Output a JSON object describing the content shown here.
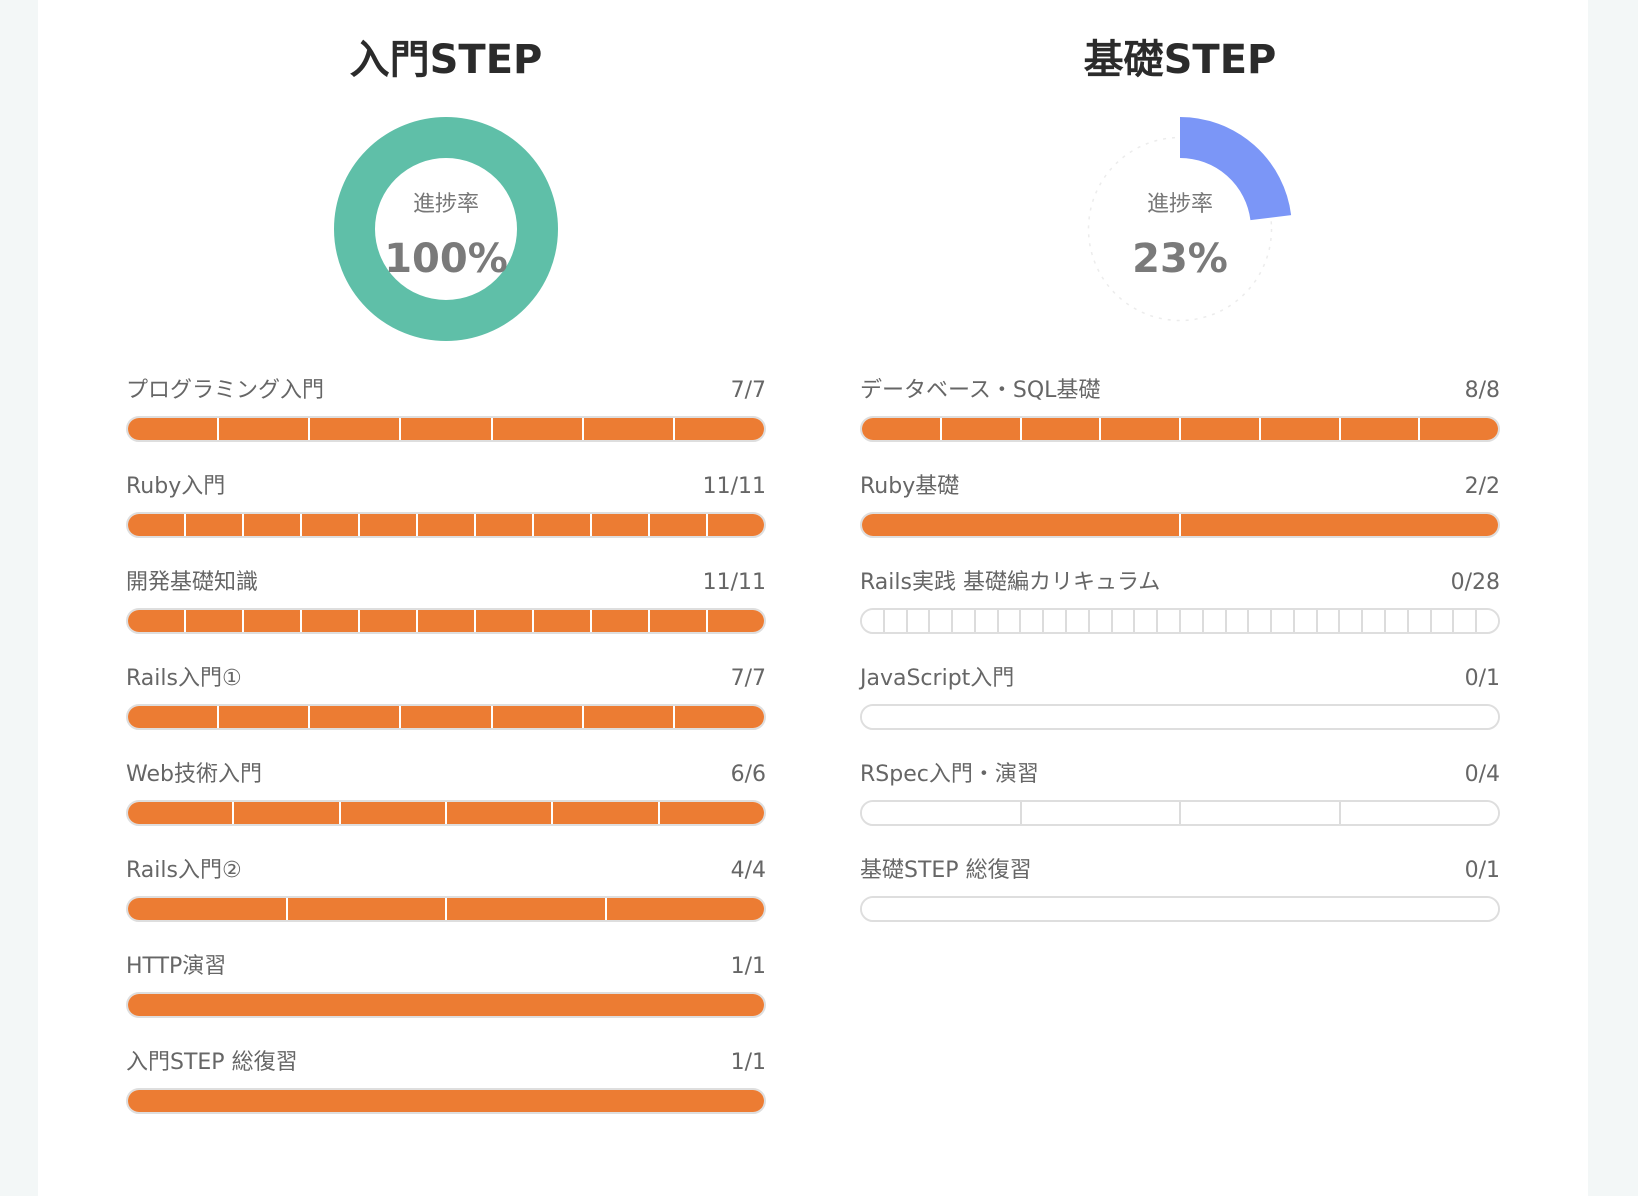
{
  "progress_label": "進捗率",
  "steps": [
    {
      "title": "入門STEP",
      "percent_text": "100%",
      "percent": 100,
      "color": "#5fbfa8",
      "courses": [
        {
          "name": "プログラミング入門",
          "count": "7/7",
          "done": 7,
          "total": 7
        },
        {
          "name": "Ruby入門",
          "count": "11/11",
          "done": 11,
          "total": 11
        },
        {
          "name": "開発基礎知識",
          "count": "11/11",
          "done": 11,
          "total": 11
        },
        {
          "name": "Rails入門①",
          "count": "7/7",
          "done": 7,
          "total": 7
        },
        {
          "name": "Web技術入門",
          "count": "6/6",
          "done": 6,
          "total": 6
        },
        {
          "name": "Rails入門②",
          "count": "4/4",
          "done": 4,
          "total": 4
        },
        {
          "name": "HTTP演習",
          "count": "1/1",
          "done": 1,
          "total": 1
        },
        {
          "name": "入門STEP 総復習",
          "count": "1/1",
          "done": 1,
          "total": 1
        }
      ]
    },
    {
      "title": "基礎STEP",
      "percent_text": "23%",
      "percent": 23,
      "color": "#7b96f7",
      "courses": [
        {
          "name": "データベース・SQL基礎",
          "count": "8/8",
          "done": 8,
          "total": 8
        },
        {
          "name": "Ruby基礎",
          "count": "2/2",
          "done": 2,
          "total": 2
        },
        {
          "name": "Rails実践 基礎編カリキュラム",
          "count": "0/28",
          "done": 0,
          "total": 28
        },
        {
          "name": "JavaScript入門",
          "count": "0/1",
          "done": 0,
          "total": 1
        },
        {
          "name": "RSpec入門・演習",
          "count": "0/4",
          "done": 0,
          "total": 4
        },
        {
          "name": "基礎STEP 総復習",
          "count": "0/1",
          "done": 0,
          "total": 1
        }
      ]
    }
  ],
  "colors": {
    "bar_done": "#ec7c33",
    "bar_empty": "#ffffff"
  }
}
